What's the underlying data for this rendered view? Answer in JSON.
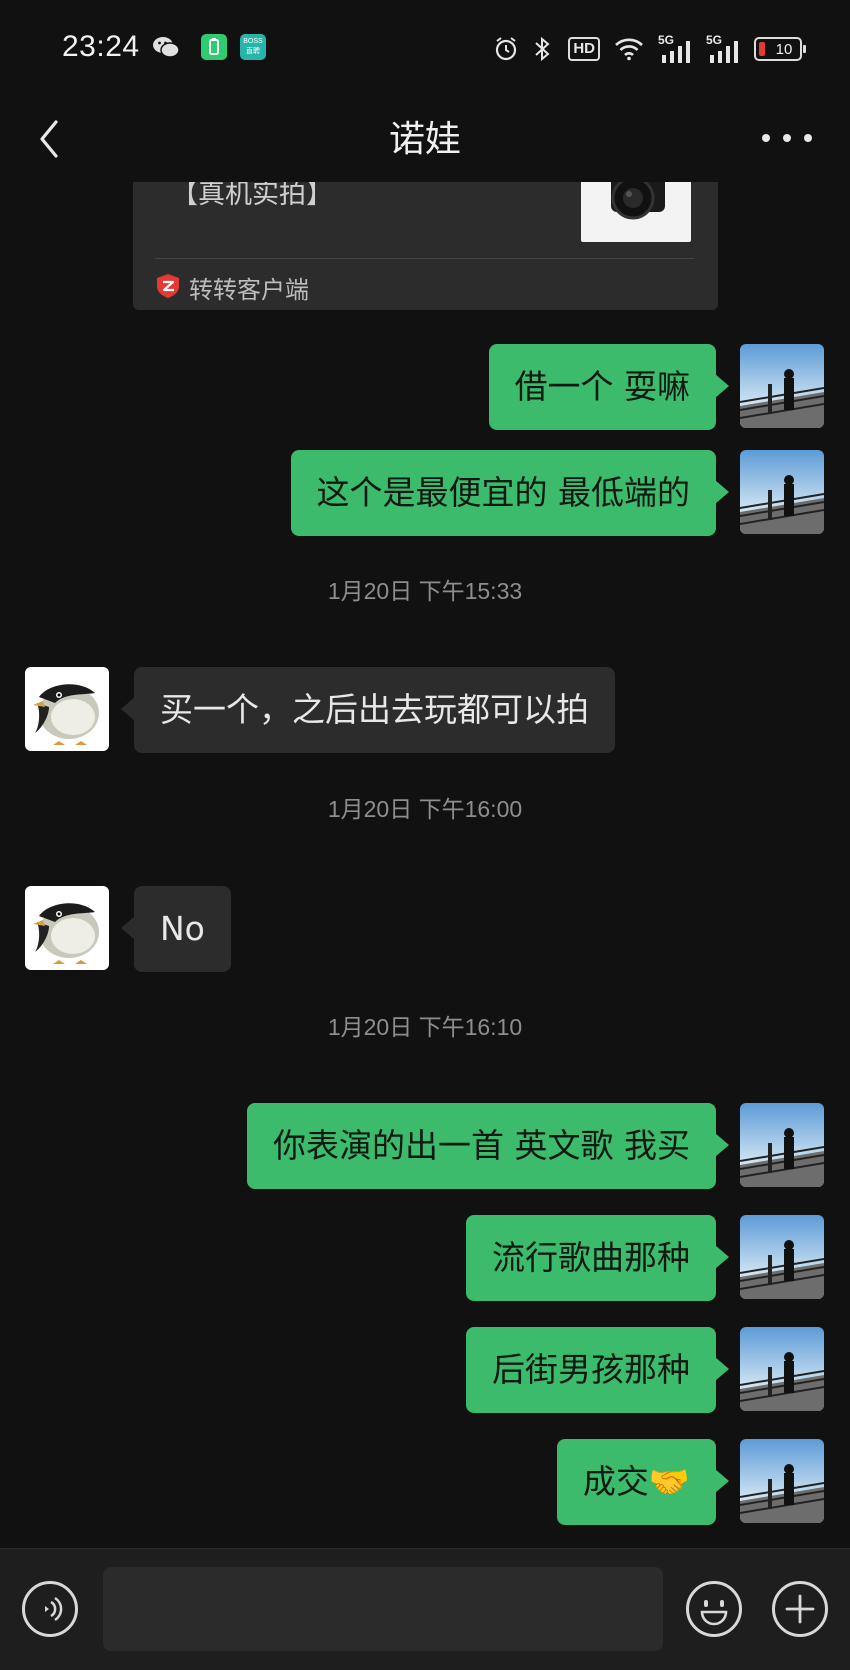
{
  "status_bar": {
    "time": "23:24",
    "apps": [
      "wechat-icon",
      "battery-app-icon",
      "boss-app-icon"
    ],
    "boss_label": "BOSS\n直聘",
    "signal_1": "5G",
    "signal_2": "5G",
    "hd_label": "HD",
    "battery_level": "10"
  },
  "header": {
    "title": "诺娃"
  },
  "shared_card": {
    "text": "【真机实拍】",
    "source": "转转客户端"
  },
  "messages": [
    {
      "type": "out",
      "text": "借一个 耍嘛"
    },
    {
      "type": "out",
      "text": "这个是最便宜的 最低端的"
    },
    {
      "type": "time",
      "text": "1月20日 下午15:33"
    },
    {
      "type": "in",
      "text": "买一个，之后出去玩都可以拍"
    },
    {
      "type": "time",
      "text": "1月20日 下午16:00"
    },
    {
      "type": "in",
      "text": "No"
    },
    {
      "type": "time",
      "text": "1月20日 下午16:10"
    },
    {
      "type": "out",
      "text": "你表演的出一首 英文歌 我买"
    },
    {
      "type": "out",
      "text": "流行歌曲那种"
    },
    {
      "type": "out",
      "text": "后街男孩那种"
    },
    {
      "type": "out",
      "text": "成交🤝"
    }
  ],
  "input": {
    "placeholder": "",
    "value": ""
  },
  "colors": {
    "background": "#111111",
    "outgoing_bubble": "#3dbb6d",
    "incoming_bubble": "#2c2c2c",
    "battery_low": "#e53935"
  }
}
